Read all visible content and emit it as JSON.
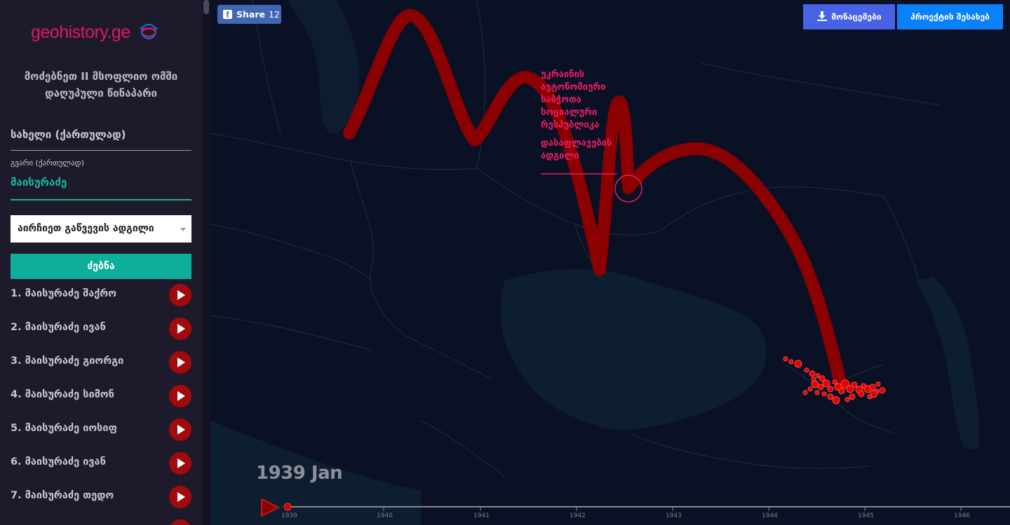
{
  "site": {
    "logo_text": "geohistory.ge"
  },
  "sidebar": {
    "intro": "მოძებნეთ II მსოფლიო ომში დაღუპული წინაპარი",
    "name_placeholder": "სახელი (ქართულად)",
    "lastname_label": "გვარი (ქართულად)",
    "lastname_value": "მაისურაძე",
    "place_select": "აირჩიეთ გაწვევის ადგილი",
    "search_button": "ძებნა",
    "results": [
      {
        "label": "1. მაისურაძე შაქრო"
      },
      {
        "label": "2. მაისურაძე ივან"
      },
      {
        "label": "3. მაისურაძე გიორგი"
      },
      {
        "label": "4. მაისურაძე სიმონ"
      },
      {
        "label": "5. მაისურაძე იოსიფ"
      },
      {
        "label": "6. მაისურაძე ივან"
      },
      {
        "label": "7. მაისურაძე თედო"
      }
    ]
  },
  "topbar": {
    "share_label": "Share",
    "share_count": "12",
    "data_button": "მონაცემები",
    "about_button": "პროექტის შესახებ"
  },
  "annotation": {
    "region": "უკრაინის ავტონომიური საბჭოთა სოციალური რესპუბლიკა",
    "caption": "დასაფლავების ადგილი"
  },
  "timeline": {
    "current": "1939 Jan",
    "ticks": [
      "1939",
      "1940",
      "1941",
      "1942",
      "1943",
      "1944",
      "1945",
      "1946"
    ]
  },
  "colors": {
    "accent_pink": "#e91e63",
    "path_red": "#8b0000",
    "teal": "#0fae9b",
    "play_red": "#a20a0c"
  },
  "icons": {
    "play": "play-icon",
    "download": "download-icon",
    "facebook": "facebook-icon",
    "logo": "globe-logo-icon"
  }
}
